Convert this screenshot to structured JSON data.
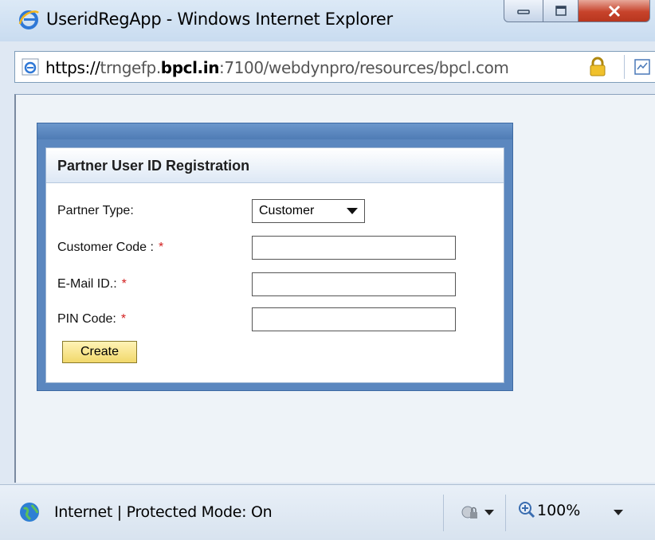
{
  "window": {
    "title": "UseridRegApp - Windows Internet Explorer"
  },
  "address_bar": {
    "url_scheme": "https://",
    "url_host_prefix": "trngefp.",
    "url_host_domain": "bpcl.in",
    "url_rest": ":7100/webdynpro/resources/bpcl.com",
    "icons": [
      "ie-page-icon",
      "lock-icon",
      "compatibility-view-icon"
    ]
  },
  "form": {
    "title": "Partner User ID Registration",
    "partner_type_label": "Partner Type:",
    "partner_type_value": "Customer",
    "customer_code_label": "Customer Code :",
    "email_label": "E-Mail ID.:",
    "pin_label": "PIN Code:",
    "required_marker": "*",
    "customer_code_value": "",
    "email_value": "",
    "pin_value": "",
    "create_label": "Create"
  },
  "status_bar": {
    "zone_text": "Internet | Protected Mode: On",
    "zoom_text": "100%"
  },
  "colors": {
    "panel_border": "#5b87bf",
    "required": "#d21f1f",
    "button_fill": "#f1d86b"
  }
}
